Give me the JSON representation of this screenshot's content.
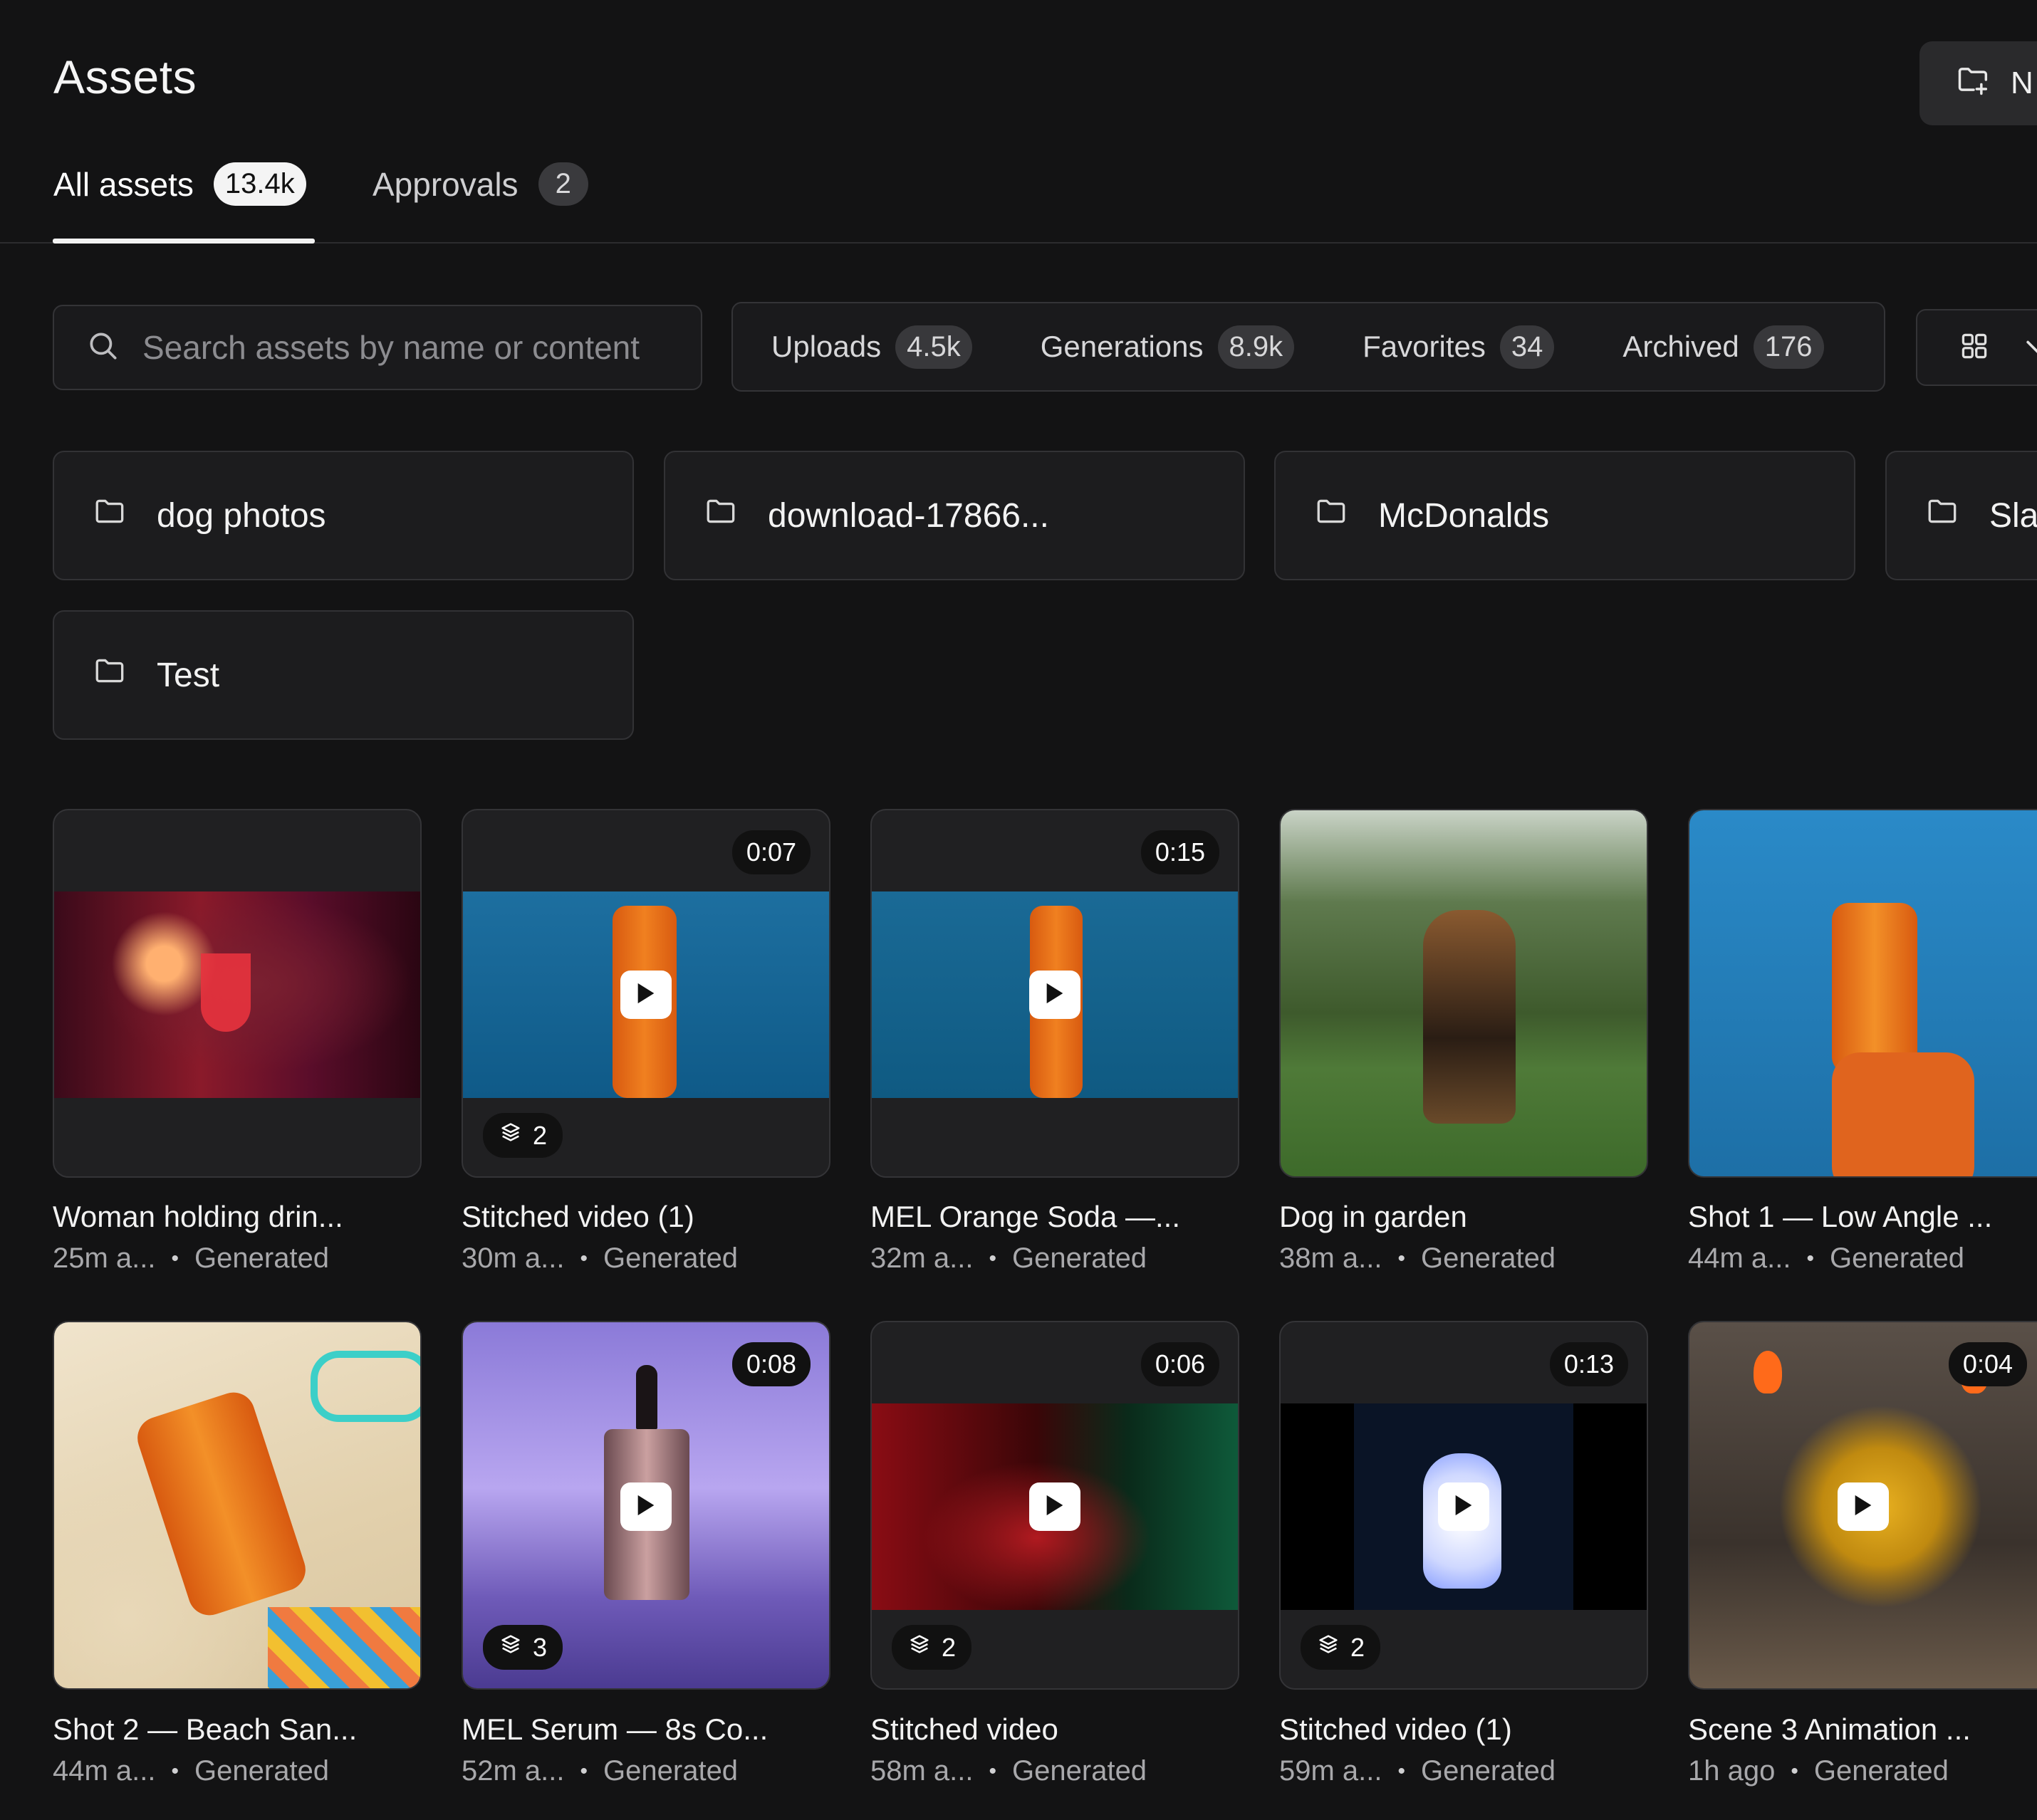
{
  "header": {
    "title": "Assets",
    "new_button_label": "N"
  },
  "tabs": [
    {
      "label": "All assets",
      "count": "13.4k",
      "active": true
    },
    {
      "label": "Approvals",
      "count": "2",
      "active": false
    }
  ],
  "search": {
    "placeholder": "Search assets by name or content",
    "value": ""
  },
  "filters": [
    {
      "label": "Uploads",
      "count": "4.5k"
    },
    {
      "label": "Generations",
      "count": "8.9k"
    },
    {
      "label": "Favorites",
      "count": "34"
    },
    {
      "label": "Archived",
      "count": "176"
    }
  ],
  "folders": [
    {
      "name": "dog photos"
    },
    {
      "name": "download-17866..."
    },
    {
      "name": "McDonalds"
    },
    {
      "name": "Sla"
    },
    {
      "name": "Test"
    }
  ],
  "assets": [
    {
      "title": "Woman holding drin...",
      "time": "25m a...",
      "source": "Generated",
      "duration": "",
      "stack": ""
    },
    {
      "title": "Stitched video (1)",
      "time": "30m a...",
      "source": "Generated",
      "duration": "0:07",
      "stack": "2"
    },
    {
      "title": "MEL Orange Soda —...",
      "time": "32m a...",
      "source": "Generated",
      "duration": "0:15",
      "stack": ""
    },
    {
      "title": "Dog in garden",
      "time": "38m a...",
      "source": "Generated",
      "duration": "",
      "stack": ""
    },
    {
      "title": "Shot 1 — Low Angle ...",
      "time": "44m a...",
      "source": "Generated",
      "duration": "",
      "stack": ""
    },
    {
      "title": "Shot 2 — Beach San...",
      "time": "44m a...",
      "source": "Generated",
      "duration": "",
      "stack": ""
    },
    {
      "title": "MEL Serum — 8s Co...",
      "time": "52m a...",
      "source": "Generated",
      "duration": "0:08",
      "stack": "3"
    },
    {
      "title": "Stitched video",
      "time": "58m a...",
      "source": "Generated",
      "duration": "0:06",
      "stack": "2"
    },
    {
      "title": "Stitched video (1)",
      "time": "59m a...",
      "source": "Generated",
      "duration": "0:13",
      "stack": "2"
    },
    {
      "title": "Scene 3 Animation ...",
      "time": "1h ago",
      "source": "Generated",
      "duration": "0:04",
      "stack": ""
    }
  ],
  "meta_separator": "•",
  "icons": {
    "search": "search-icon",
    "folder": "folder-icon",
    "new_folder": "folder-plus-icon",
    "grid": "grid-icon",
    "chevron": "chevron-down-icon",
    "stack": "layers-icon",
    "play": "play-icon"
  }
}
